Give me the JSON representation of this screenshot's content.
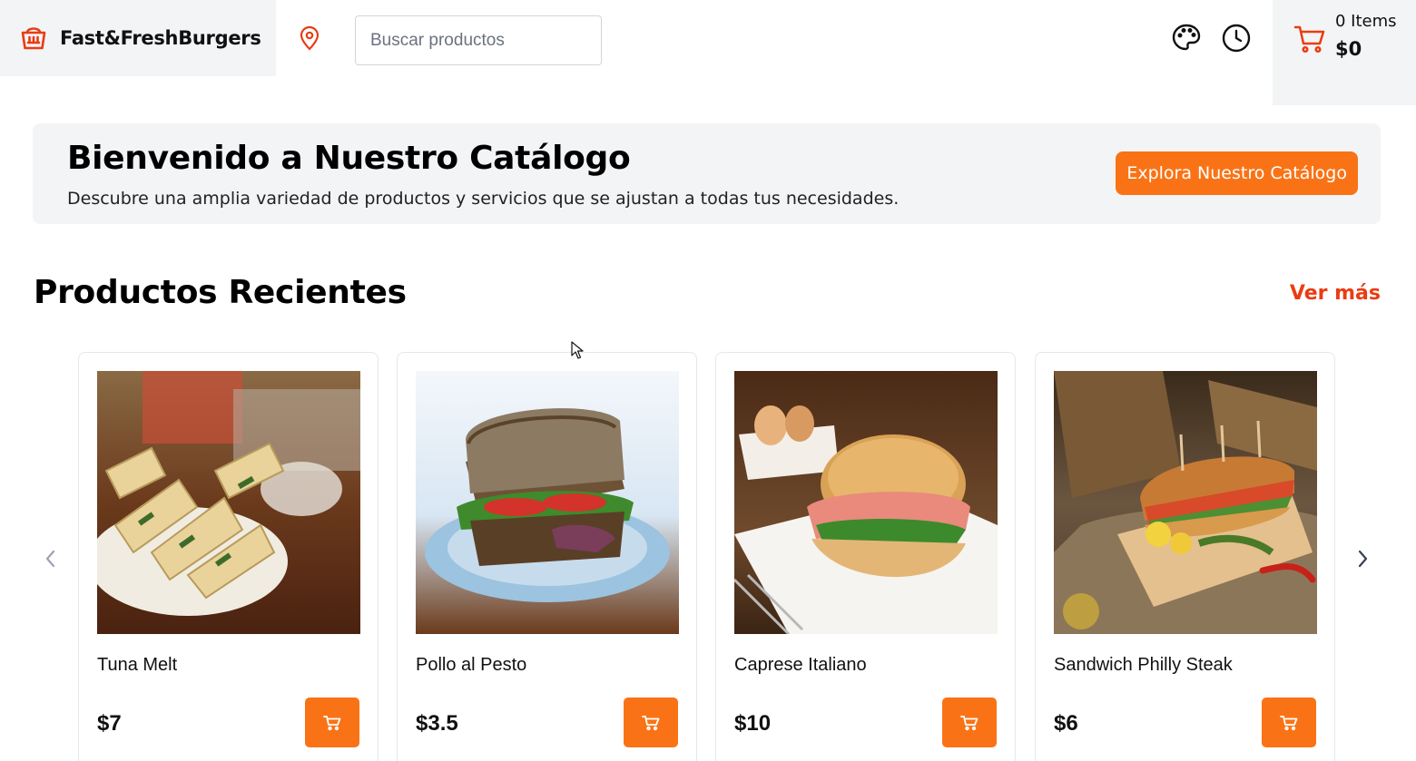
{
  "header": {
    "brand": "Fast&FreshBurgers",
    "brand_icon": "store-basket-icon",
    "location_icon": "map-pin-icon",
    "search_placeholder": "Buscar productos",
    "theme_icon": "palette-icon",
    "history_icon": "clock-icon",
    "cart": {
      "items_label": "0 Items",
      "total": "$0",
      "icon": "cart-icon"
    }
  },
  "banner": {
    "title": "Bienvenido a Nuestro Catálogo",
    "subtitle": "Descubre una amplia variedad de productos y servicios que se ajustan a todas tus necesidades.",
    "button": "Explora Nuestro Catálogo"
  },
  "recent": {
    "title": "Productos Recientes",
    "see_more": "Ver más",
    "products": [
      {
        "name": "Tuna Melt",
        "price": "$7"
      },
      {
        "name": "Pollo al Pesto",
        "price": "$3.5"
      },
      {
        "name": "Caprese Italiano",
        "price": "$10"
      },
      {
        "name": "Sandwich Philly Steak",
        "price": "$6"
      }
    ]
  },
  "colors": {
    "accent": "#f97316",
    "link": "#ea3c12",
    "panel": "#f3f4f6"
  }
}
